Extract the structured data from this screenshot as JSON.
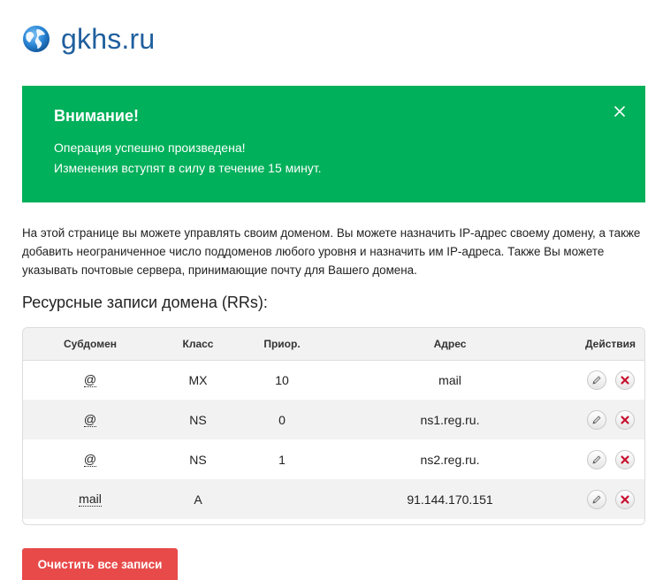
{
  "header": {
    "site_title": "gkhs.ru",
    "logo_icon": "globe-icon"
  },
  "alert": {
    "title": "Внимание!",
    "lines": [
      "Операция успешно произведена!",
      "Изменения вступят в силу в течение 15 минут."
    ],
    "background_color": "#00b05a",
    "close_icon": "close-icon"
  },
  "intro": {
    "text": "На этой странице вы можете управлять своим доменом. Вы можете назначить IP-адрес своему домену, а также добавить неограниченное число поддоменов любого уровня и назначить им IP-адреса. Также Вы можете указывать почтовые сервера, принимающие почту для Вашего домена."
  },
  "records": {
    "section_title": "Ресурсные записи домена (RRs):",
    "columns": {
      "subdomain": "Субдомен",
      "class": "Класс",
      "priority": "Приор.",
      "address": "Адрес",
      "actions": "Действия"
    },
    "rows": [
      {
        "subdomain": "@",
        "class": "MX",
        "priority": "10",
        "address": "mail"
      },
      {
        "subdomain": "@",
        "class": "NS",
        "priority": "0",
        "address": "ns1.reg.ru."
      },
      {
        "subdomain": "@",
        "class": "NS",
        "priority": "1",
        "address": "ns2.reg.ru."
      },
      {
        "subdomain": "mail",
        "class": "A",
        "priority": "",
        "address": "91.144.170.151"
      }
    ],
    "edit_icon": "pencil-icon",
    "delete_icon": "delete-x-icon"
  },
  "footer": {
    "clear_all_label": "Очистить все записи",
    "clear_button_color": "#e84a4a"
  }
}
